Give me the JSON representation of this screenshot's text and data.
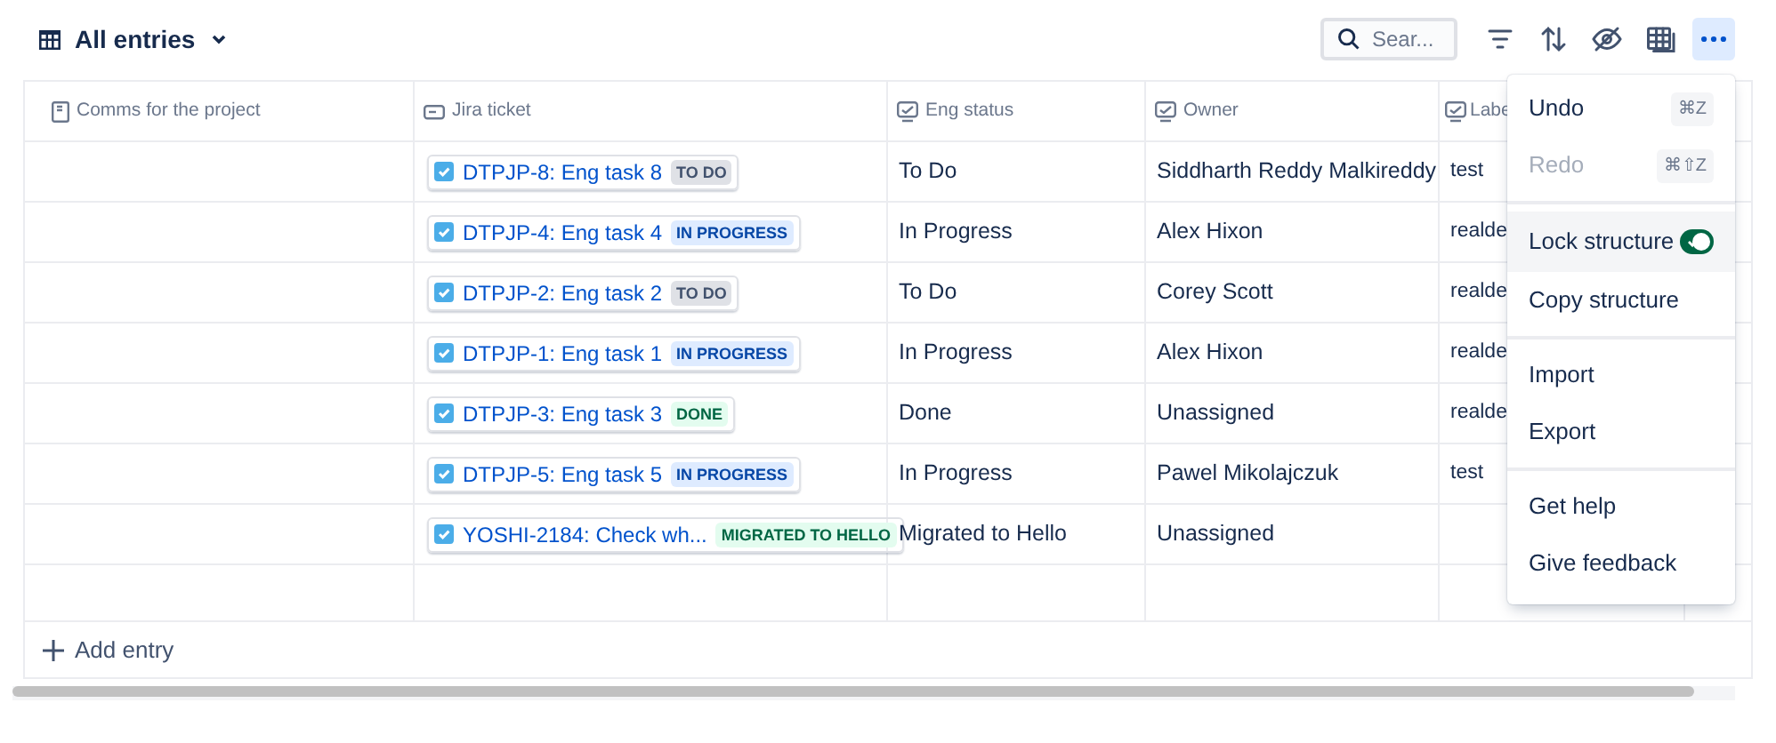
{
  "view": {
    "label": "All entries"
  },
  "search": {
    "placeholder": "Sear..."
  },
  "toolbar": [
    {
      "kind": "filter",
      "selected": false
    },
    {
      "kind": "sort",
      "selected": false
    },
    {
      "kind": "hide",
      "selected": false
    },
    {
      "kind": "table",
      "selected": false
    },
    {
      "kind": "more",
      "selected": true
    }
  ],
  "table": {
    "columns": [
      {
        "label": "Comms for the project",
        "kind": "page"
      },
      {
        "label": "Jira ticket",
        "kind": "jira"
      },
      {
        "label": "Eng status",
        "kind": "field"
      },
      {
        "label": "Owner",
        "kind": "field"
      },
      {
        "label": "Labe",
        "kind": "field"
      }
    ],
    "rows": [
      {
        "ticket": "DTPJP-8: Eng task 8",
        "status": "TO DO",
        "color": "#42526e",
        "eng_status": "To Do",
        "owner": "Siddharth Reddy Malkireddy",
        "labels": "test"
      },
      {
        "ticket": "DTPJP-4: Eng task 4",
        "status": "IN PROGRESS",
        "color": "#0747a6",
        "eng_status": "In Progress",
        "owner": "Alex Hixon",
        "labels": "realde"
      },
      {
        "ticket": "DTPJP-2: Eng task 2",
        "status": "TO DO",
        "color": "#42526e",
        "eng_status": "To Do",
        "owner": "Corey Scott",
        "labels": "realde"
      },
      {
        "ticket": "DTPJP-1: Eng task 1",
        "status": "IN PROGRESS",
        "color": "#0747a6",
        "eng_status": "In Progress",
        "owner": "Alex Hixon",
        "labels": "realde"
      },
      {
        "ticket": "DTPJP-3: Eng task 3",
        "status": "DONE",
        "color": "#006644",
        "eng_status": "Done",
        "owner": "Unassigned",
        "labels": "realde"
      },
      {
        "ticket": "DTPJP-5: Eng task 5",
        "status": "IN PROGRESS",
        "color": "#0747a6",
        "eng_status": "In Progress",
        "owner": "Pawel Mikolajczuk",
        "labels": "test"
      },
      {
        "ticket": "YOSHI-2184: Check wh...",
        "status": "MIGRATED TO HELLO",
        "color": "#006644",
        "eng_status": "Migrated to Hello",
        "owner": "Unassigned"
      }
    ],
    "add_entry": "Add entry"
  },
  "menu": {
    "groups": [
      [
        {
          "label": "Undo",
          "shortcut": "⌘Z",
          "disabled": false,
          "highlighted": false,
          "kind": "action"
        },
        {
          "label": "Redo",
          "shortcut": "⌘⇧Z",
          "disabled": true,
          "highlighted": false,
          "kind": "action"
        }
      ],
      [
        {
          "label": "Lock structure",
          "disabled": false,
          "highlighted": true,
          "kind": "toggle",
          "on": true
        },
        {
          "label": "Copy structure",
          "disabled": false,
          "highlighted": false,
          "kind": "action"
        }
      ],
      [
        {
          "label": "Import",
          "disabled": false,
          "highlighted": false,
          "kind": "action"
        },
        {
          "label": "Export",
          "disabled": false,
          "highlighted": false,
          "kind": "action"
        }
      ],
      [
        {
          "label": "Get help",
          "disabled": false,
          "highlighted": false,
          "kind": "action"
        },
        {
          "label": "Give feedback",
          "disabled": false,
          "highlighted": false,
          "kind": "action"
        }
      ]
    ]
  }
}
